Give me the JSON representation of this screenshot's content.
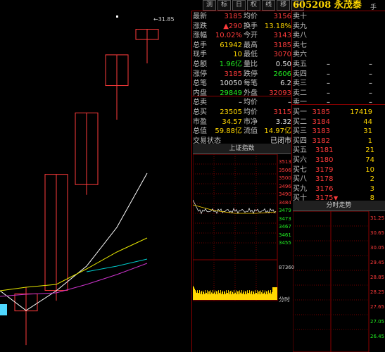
{
  "toolbar": {
    "buttons": [
      "测",
      "标",
      "日",
      "权",
      "线",
      "移",
      "+"
    ]
  },
  "stock": {
    "code": "605208",
    "name": "永茂泰",
    "corner_label": "手"
  },
  "kline": {
    "price_label": "31.85",
    "candles": [
      {
        "open": 23.6,
        "close": 24.1,
        "high": 24.3,
        "low": 22.6,
        "dir": "up"
      },
      {
        "open": 24.2,
        "close": 27.6,
        "high": 27.6,
        "low": 23.9,
        "dir": "up"
      },
      {
        "open": 27.3,
        "close": 29.4,
        "high": 29.4,
        "low": 27.0,
        "dir": "up"
      },
      {
        "open": 30.2,
        "close": 31.1,
        "high": 31.1,
        "low": 29.2,
        "dir": "up"
      },
      {
        "open": 31.55,
        "close": 31.85,
        "high": 31.85,
        "low": 30.85,
        "dir": "up"
      }
    ],
    "ma_colors": [
      "#ffffff",
      "#e6e600",
      "#cc33cc",
      "#00cccc"
    ]
  },
  "quote_rows": [
    {
      "l1": "最新",
      "v1": "3185",
      "c1": "red",
      "l2": "均价",
      "v2": "3156",
      "c2": "red",
      "l3": "卖十",
      "v3": "",
      "v4": ""
    },
    {
      "l1": "涨跌",
      "v1": "▲290",
      "c1": "red",
      "l2": "换手",
      "v2": "13.18%",
      "c2": "yellow",
      "l3": "卖九",
      "v3": "",
      "v4": ""
    },
    {
      "l1": "涨幅",
      "v1": "10.02%",
      "c1": "red",
      "l2": "今开",
      "v2": "3143",
      "c2": "red",
      "l3": "卖八",
      "v3": "",
      "v4": ""
    },
    {
      "l1": "总手",
      "v1": "61942",
      "c1": "yellow",
      "l2": "最高",
      "v2": "3185",
      "c2": "red",
      "l3": "卖七",
      "v3": "",
      "v4": ""
    },
    {
      "l1": "现手",
      "v1": "10",
      "c1": "yellow",
      "l2": "最低",
      "v2": "3070",
      "c2": "red",
      "l3": "卖六",
      "v3": "",
      "v4": ""
    },
    {
      "l1": "总额",
      "v1": "1.96亿",
      "c1": "green",
      "l2": "量比",
      "v2": "0.50",
      "c2": "white",
      "l3": "卖五",
      "v3": "–",
      "v4": "–"
    },
    {
      "l1": "涨停",
      "v1": "3185",
      "c1": "red",
      "l2": "跌停",
      "v2": "2606",
      "c2": "green",
      "l3": "卖四",
      "v3": "–",
      "v4": "–"
    },
    {
      "l1": "总笔",
      "v1": "10050",
      "c1": "white",
      "l2": "每笔",
      "v2": "6.2",
      "c2": "white",
      "l3": "卖三",
      "v3": "–",
      "v4": "–"
    },
    {
      "l1": "内盘",
      "v1": "29849",
      "c1": "green",
      "l2": "外盘",
      "v2": "32093",
      "c2": "red",
      "l3": "卖二",
      "v3": "–",
      "v4": "–"
    },
    {
      "l1": "总卖",
      "v1": "–",
      "c1": "white",
      "l2": "均价",
      "v2": "–",
      "c2": "white",
      "l3": "卖一",
      "v3": "–",
      "v4": "–"
    },
    {
      "l1": "总买",
      "v1": "23505",
      "c1": "yellow",
      "l2": "均价",
      "v2": "3115",
      "c2": "red",
      "l3": "买一",
      "v3": "3185",
      "v4": "17419"
    },
    {
      "l1": "市盈",
      "v1": "34.57",
      "c1": "yellow",
      "l2": "市净",
      "v2": "3.32",
      "c2": "white",
      "l3": "买二",
      "v3": "3184",
      "v4": "44"
    },
    {
      "l1": "总值",
      "v1": "59.88亿",
      "c1": "yellow",
      "l2": "流值",
      "v2": "14.97亿",
      "c2": "yellow",
      "l3": "买三",
      "v3": "3183",
      "v4": "31"
    },
    {
      "l1": "交易状态",
      "v1": "",
      "c1": "white",
      "l2": "",
      "v2": "已闭市",
      "c2": "white",
      "l3": "买四",
      "v3": "3182",
      "v4": "1"
    }
  ],
  "order_book_extra": [
    {
      "label": "买五",
      "price": "3181",
      "vol": "21"
    },
    {
      "label": "买六",
      "price": "3180",
      "vol": "74"
    },
    {
      "label": "买七",
      "price": "3179",
      "vol": "10"
    },
    {
      "label": "买八",
      "price": "3178",
      "vol": "2"
    },
    {
      "label": "买九",
      "price": "3176",
      "vol": "3"
    },
    {
      "label": "买十",
      "price": "3175",
      "vol": "8",
      "marker": "▼"
    }
  ],
  "index_panel": {
    "title": "上证指数",
    "axis": [
      "3513",
      "3506",
      "3500",
      "3496",
      "3490",
      "3484",
      "3479",
      "3473",
      "3467",
      "3461",
      "3455"
    ],
    "vol_label": "87360",
    "footer": "分时"
  },
  "intraday_panel": {
    "title": "分时走势",
    "axis": [
      "31.25",
      "30.65",
      "30.05",
      "29.45",
      "28.85",
      "28.25",
      "27.65",
      "27.05",
      "26.45"
    ]
  }
}
